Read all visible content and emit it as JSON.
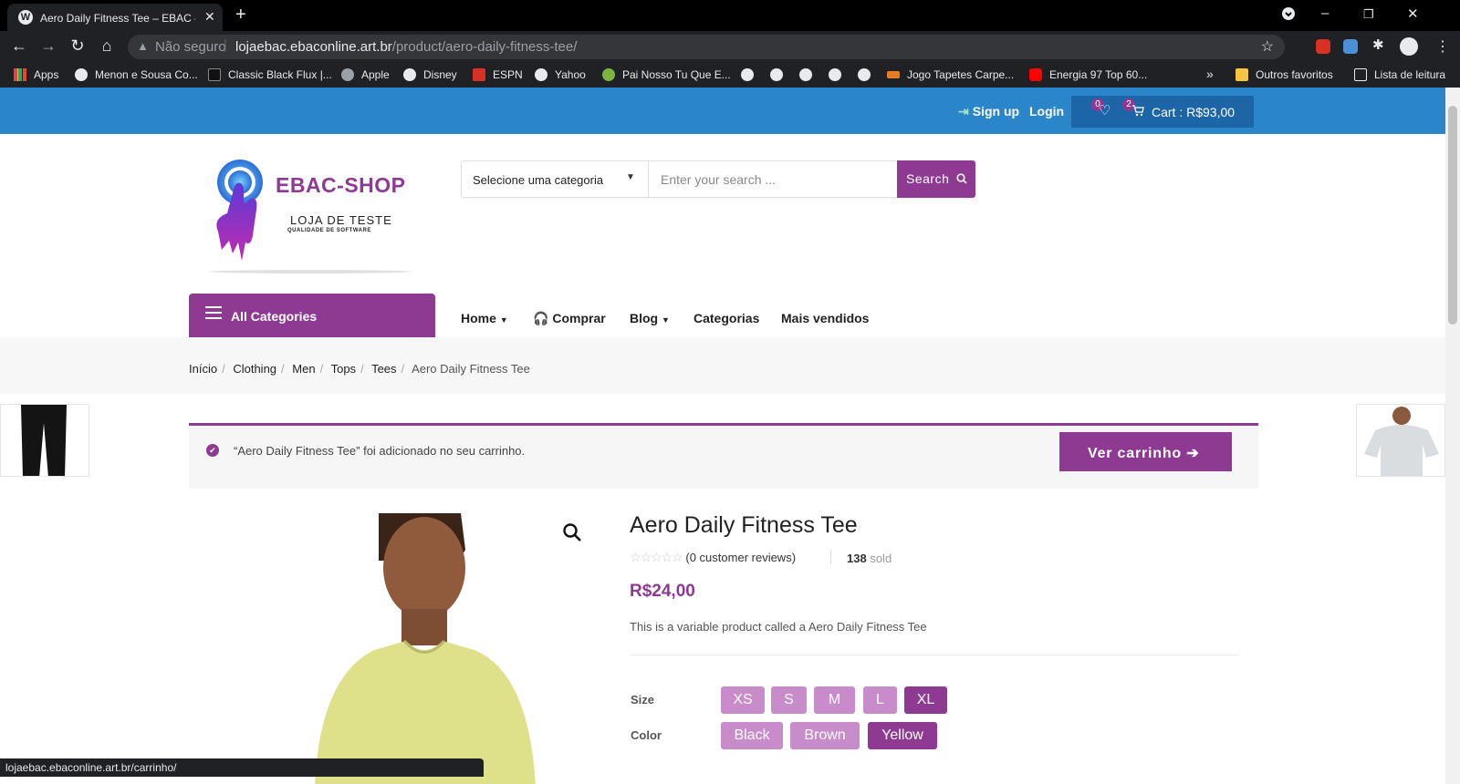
{
  "browser": {
    "tab_title": "Aero Daily Fitness Tee – EBAC – S",
    "tab_icon": "wordpress-icon",
    "security_label": "Não seguro",
    "url_host": "lojaebac.ebaconline.art.br",
    "url_path": "/product/aero-daily-fitness-tee/",
    "status_url": "lojaebac.ebaconline.art.br/carrinho/"
  },
  "bookmarks": {
    "items": [
      {
        "label": "Apps"
      },
      {
        "label": "Menon e Sousa Co..."
      },
      {
        "label": "Classic Black Flux |..."
      },
      {
        "label": "Apple"
      },
      {
        "label": "Disney"
      },
      {
        "label": "ESPN"
      },
      {
        "label": "Yahoo"
      },
      {
        "label": "Pai Nosso Tu Que E..."
      },
      {
        "label": "Jogo Tapetes Carpe..."
      },
      {
        "label": "Energia 97 Top 60..."
      }
    ],
    "overflow": "»",
    "other_favorites": "Outros favoritos",
    "reading_list": "Lista de leitura"
  },
  "topbar": {
    "signup": "Sign up",
    "login": "Login",
    "wishlist_count": "0",
    "cart_count": "2",
    "cart_label": "Cart : R$93,00"
  },
  "header": {
    "brand": "EBAC-SHOP",
    "tagline": "LOJA DE TESTE",
    "subtagline": "QUALIDADE DE SOFTWARE",
    "category_select": "Selecione uma categoria",
    "search_placeholder": "Enter your search ...",
    "search_button": "Search"
  },
  "nav": {
    "all_categories": "All Categories",
    "items": [
      {
        "label": "Home"
      },
      {
        "label": "Comprar"
      },
      {
        "label": "Blog"
      },
      {
        "label": "Categorias"
      },
      {
        "label": "Mais vendidos"
      }
    ]
  },
  "breadcrumb": [
    "Início",
    "Clothing",
    "Men",
    "Tops",
    "Tees",
    "Aero Daily Fitness Tee"
  ],
  "notice": {
    "message": "“Aero Daily Fitness Tee” foi adicionado no seu carrinho.",
    "button": "Ver carrinho"
  },
  "product": {
    "title": "Aero Daily Fitness Tee",
    "reviews": "(0 customer reviews)",
    "sold_count": "138",
    "sold_label": "sold",
    "price": "R$24,00",
    "description": "This is a variable product called a Aero Daily Fitness Tee",
    "size_label": "Size",
    "sizes": [
      "XS",
      "S",
      "M",
      "L",
      "XL"
    ],
    "selected_size": "XL",
    "color_label": "Color",
    "colors": [
      "Black",
      "Brown",
      "Yellow"
    ],
    "selected_color": "Yellow"
  },
  "colors": {
    "accent": "#8e3a93",
    "topbar": "#2a86c8",
    "swatch": "#c98ccb"
  }
}
